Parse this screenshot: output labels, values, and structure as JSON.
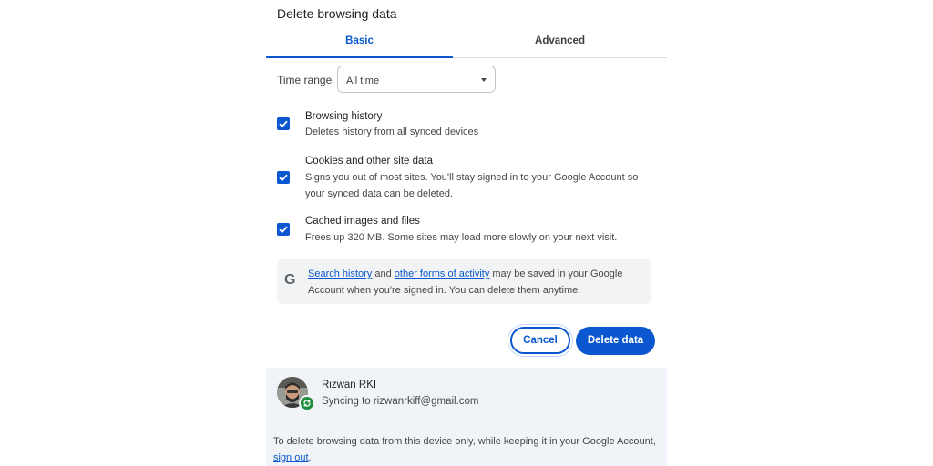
{
  "dialog": {
    "title": "Delete browsing data",
    "tabs": [
      {
        "label": "Basic",
        "selected": true
      },
      {
        "label": "Advanced",
        "selected": false
      }
    ]
  },
  "time_range": {
    "label": "Time range",
    "value": "All time"
  },
  "options": [
    {
      "title": "Browsing history",
      "description": "Deletes history from all synced devices",
      "checked": true
    },
    {
      "title": "Cookies and other site data",
      "description": "Signs you out of most sites. You'll stay signed in to your Google Account so your synced data can be deleted.",
      "checked": true
    },
    {
      "title": "Cached images and files",
      "description": "Frees up 320 MB. Some sites may load more slowly on your next visit.",
      "checked": true
    }
  ],
  "info": {
    "icon": "google-g-icon",
    "link1": "Search history",
    "text1": " and ",
    "link2": "other forms of activity",
    "text2": " may be saved in your Google Account when you're signed in. You can delete them anytime."
  },
  "buttons": {
    "cancel": "Cancel",
    "delete": "Delete data"
  },
  "account": {
    "name": "Rizwan RKI",
    "sync_status": "Syncing to rizwanrkiff@gmail.com"
  },
  "footer": {
    "text": "To delete browsing data from this device only, while keeping it in your Google Account, ",
    "link": "sign out",
    "end": "."
  },
  "colors": {
    "accent": "#0b57d0",
    "account_bg": "#f0f4f9",
    "sync_green": "#1e8e3e"
  }
}
